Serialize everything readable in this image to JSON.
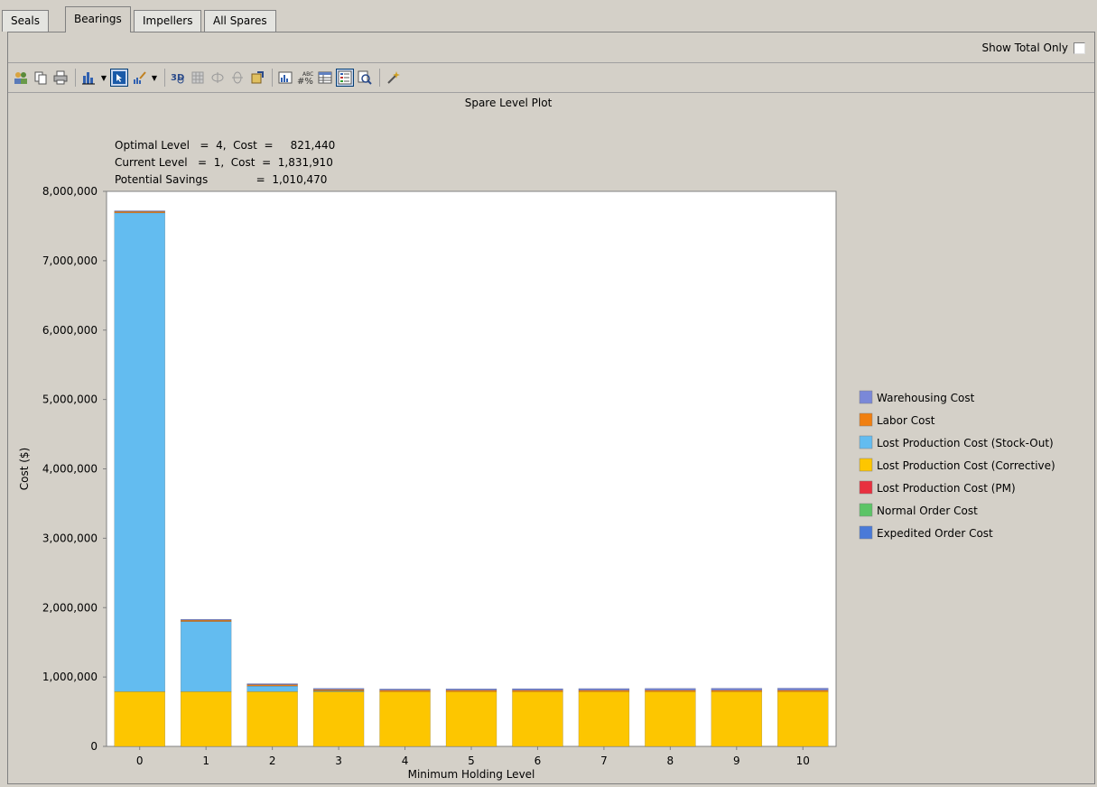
{
  "tabs": [
    "Seals",
    "Bearings",
    "Impellers",
    "All Spares"
  ],
  "active_tab": "Bearings",
  "show_total_only": {
    "label": "Show Total Only",
    "checked": false
  },
  "toolbar_icons": [
    "users-icon",
    "copy-icon",
    "print-icon",
    "bar-chart-icon",
    "dropdown-arrow-icon",
    "select-pointer-icon",
    "edit-chart-icon",
    "dropdown-arrow-icon",
    "3d-icon",
    "grid-icon",
    "rotate-horizontal-icon",
    "rotate-vertical-icon",
    "export-icon",
    "chart-properties-icon",
    "data-labels-icon",
    "table-icon",
    "legend-icon",
    "zoom-icon",
    "wizard-icon"
  ],
  "chart_data": {
    "type": "bar",
    "stacked": true,
    "title": "Spare Level Plot",
    "xlabel": "Minimum Holding Level",
    "ylabel": "Cost ($)",
    "ylim": [
      0,
      8000000
    ],
    "yticks": [
      "0",
      "1,000,000",
      "2,000,000",
      "3,000,000",
      "4,000,000",
      "5,000,000",
      "6,000,000",
      "7,000,000",
      "8,000,000"
    ],
    "categories": [
      "0",
      "1",
      "2",
      "3",
      "4",
      "5",
      "6",
      "7",
      "8",
      "9",
      "10"
    ],
    "annotations": [
      "Optimal Level   =  4,  Cost  =     821,440",
      "Current Level   =  1,  Cost  =  1,831,910",
      "Potential Savings              =  1,010,470"
    ],
    "legend_position": "right",
    "series": [
      {
        "name": "Expedited Order Cost",
        "color": "#4a7ad8",
        "values": [
          0,
          0,
          0,
          0,
          0,
          0,
          0,
          0,
          0,
          0,
          0
        ]
      },
      {
        "name": "Normal Order Cost",
        "color": "#5cc466",
        "values": [
          0,
          0,
          0,
          0,
          0,
          0,
          0,
          0,
          0,
          0,
          0
        ]
      },
      {
        "name": "Lost Production Cost (PM)",
        "color": "#e8303f",
        "values": [
          0,
          0,
          0,
          0,
          0,
          0,
          0,
          0,
          0,
          0,
          0
        ]
      },
      {
        "name": "Lost Production Cost (Corrective)",
        "color": "#fdc600",
        "values": [
          790000,
          790000,
          790000,
          790000,
          790000,
          790000,
          790000,
          790000,
          790000,
          790000,
          790000
        ]
      },
      {
        "name": "Lost Production Cost (Stock-Out)",
        "color": "#63bcf0",
        "values": [
          6900000,
          1010000,
          80000,
          10000,
          0,
          0,
          0,
          0,
          0,
          0,
          0
        ]
      },
      {
        "name": "Labor Cost",
        "color": "#f07f10",
        "values": [
          20000,
          20000,
          20000,
          20000,
          20000,
          20000,
          20000,
          20000,
          20000,
          20000,
          20000
        ]
      },
      {
        "name": "Warehousing Cost",
        "color": "#7a88d8",
        "values": [
          10000,
          12000,
          14000,
          16000,
          18000,
          20000,
          22000,
          24000,
          26000,
          28000,
          30000
        ]
      }
    ]
  }
}
